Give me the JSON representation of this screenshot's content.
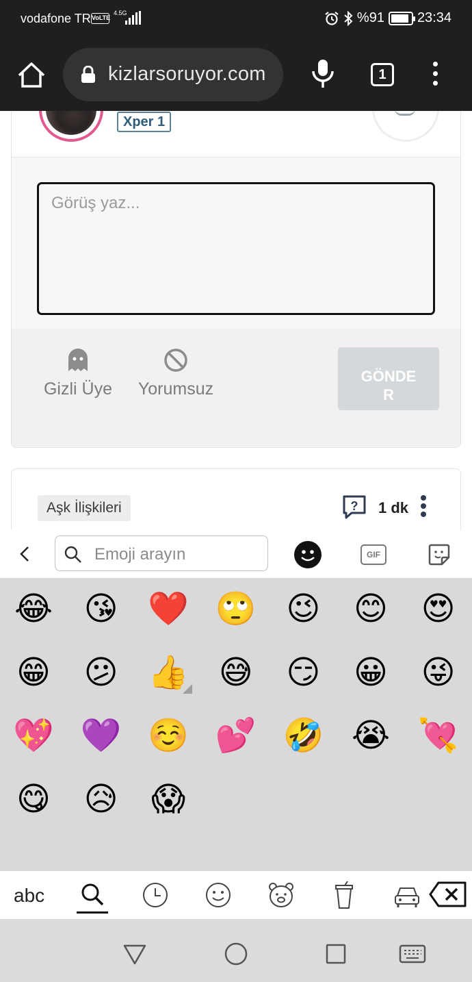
{
  "status_bar": {
    "carrier": "vodafone TR",
    "volte": "VoLTE",
    "network": "4.5G",
    "battery": "%91",
    "battery_level": 0.91,
    "time": "23:34"
  },
  "browser": {
    "url": "kizlarsoruyor.com",
    "tab_count": "1",
    "icons": [
      "home-icon",
      "lock-icon",
      "mic-icon",
      "tabs-icon",
      "more-vert-icon"
    ]
  },
  "post": {
    "xper_badge": "Xper 1",
    "comment_placeholder": "Görüş yaz...",
    "anonymous_label": "Gizli Üye",
    "no_comment_label": "Yorumsuz",
    "send_label": "GÖNDE\nR"
  },
  "next_post": {
    "tag": "Aşk İlişkileri",
    "time": "1 dk"
  },
  "emoji_keyboard": {
    "search_placeholder": "Emoji arayın",
    "gif_label": "GIF",
    "abc_label": "abc",
    "emojis": [
      "😂",
      "😘",
      "❤️",
      "🙄",
      "😉",
      "😊",
      "😍",
      "😁",
      "😕",
      "👍",
      "😅",
      "😏",
      "😀",
      "😜",
      "💖",
      "💜",
      "☺️",
      "💕",
      "🤣",
      "😭",
      "💘",
      "😋",
      "😥",
      "😱"
    ],
    "categories": [
      "search-icon",
      "recent-clock-icon",
      "smiley-icon",
      "animal-icon",
      "food-drink-icon",
      "travel-car-icon"
    ]
  },
  "colors": {
    "system_bar": "#1f1f1f",
    "url_bar": "#333333",
    "avatar_ring": "#e25a8f",
    "badge_text": "#2d5f7c",
    "send_disabled": "#d5d8db",
    "keyboard_bg": "#d9d9d9"
  }
}
